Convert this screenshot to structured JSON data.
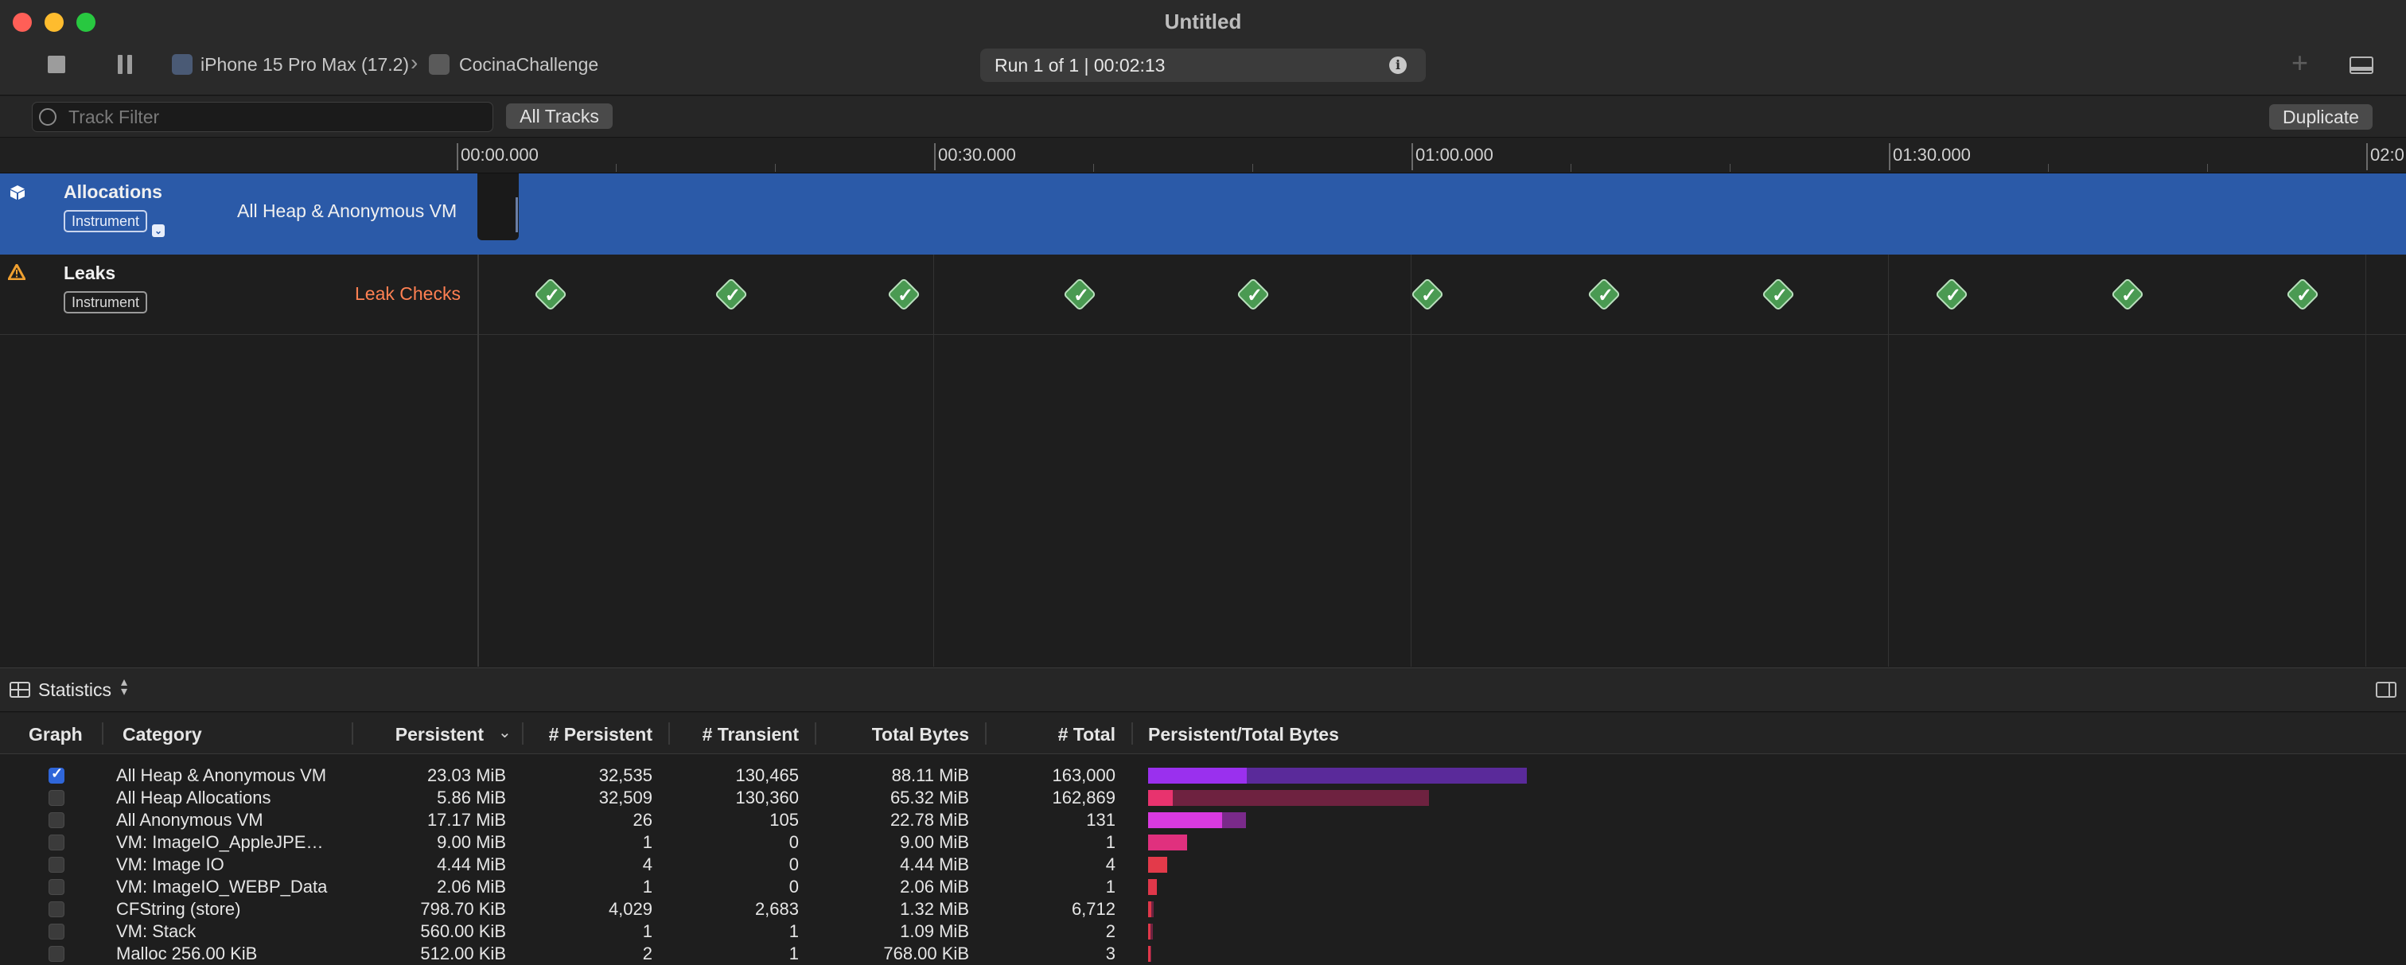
{
  "window": {
    "title": "Untitled",
    "device": "iPhone 15 Pro Max (17.2)",
    "app": "CocinaChallenge",
    "run_status": "Run 1 of 1  |  00:02:13",
    "traffic_lights": {
      "close": "#ff5f57",
      "minimize": "#febc2e",
      "zoom": "#28c840"
    }
  },
  "filterbar": {
    "placeholder": "Track Filter",
    "all_tracks": "All Tracks",
    "duplicate": "Duplicate"
  },
  "timeline": {
    "labels": [
      "00:00.000",
      "00:30.000",
      "01:00.000",
      "01:30.000",
      "02:0"
    ]
  },
  "tracks": {
    "allocations": {
      "name": "Allocations",
      "badge": "Instrument",
      "detail": "All Heap & Anonymous VM",
      "icon": "cube-icon"
    },
    "leaks": {
      "name": "Leaks",
      "badge": "Instrument",
      "detail": "Leak Checks",
      "icon": "warning-triangle-icon",
      "check_count": 11
    }
  },
  "stats": {
    "title": "Statistics",
    "columns": [
      "Graph",
      "Category",
      "Persistent",
      "# Persistent",
      "# Transient",
      "Total Bytes",
      "# Total",
      "Persistent/Total Bytes"
    ],
    "rows": [
      {
        "graph": true,
        "category": "All Heap & Anonymous VM",
        "persistent": "23.03 MiB",
        "n_persistent": "32,535",
        "n_transient": "130,465",
        "total_bytes": "88.11 MiB",
        "n_total": "163,000",
        "persistent_frac": 0.26,
        "total_frac": 1.0,
        "color": "#9a30ee",
        "color2": "#5a2a9a"
      },
      {
        "graph": false,
        "category": "All Heap Allocations",
        "persistent": "5.86 MiB",
        "n_persistent": "32,509",
        "n_transient": "130,360",
        "total_bytes": "65.32 MiB",
        "n_total": "162,869",
        "persistent_frac": 0.066,
        "total_frac": 0.741,
        "color": "#e8336e",
        "color2": "#6e2240"
      },
      {
        "graph": false,
        "category": "All Anonymous VM",
        "persistent": "17.17 MiB",
        "n_persistent": "26",
        "n_transient": "105",
        "total_bytes": "22.78 MiB",
        "n_total": "131",
        "persistent_frac": 0.195,
        "total_frac": 0.259,
        "color": "#d93ae0",
        "color2": "#7a2a8a"
      },
      {
        "graph": false,
        "category": "VM: ImageIO_AppleJPE…",
        "persistent": "9.00 MiB",
        "n_persistent": "1",
        "n_transient": "0",
        "total_bytes": "9.00 MiB",
        "n_total": "1",
        "persistent_frac": 0.102,
        "total_frac": 0.102,
        "color": "#e0307e",
        "color2": "#6e2240"
      },
      {
        "graph": false,
        "category": "VM: Image IO",
        "persistent": "4.44 MiB",
        "n_persistent": "4",
        "n_transient": "0",
        "total_bytes": "4.44 MiB",
        "n_total": "4",
        "persistent_frac": 0.05,
        "total_frac": 0.05,
        "color": "#e33a4a",
        "color2": "#6e2240"
      },
      {
        "graph": false,
        "category": "VM: ImageIO_WEBP_Data",
        "persistent": "2.06 MiB",
        "n_persistent": "1",
        "n_transient": "0",
        "total_bytes": "2.06 MiB",
        "n_total": "1",
        "persistent_frac": 0.023,
        "total_frac": 0.023,
        "color": "#e0374a",
        "color2": "#6e2240"
      },
      {
        "graph": false,
        "category": "CFString (store)",
        "persistent": "798.70 KiB",
        "n_persistent": "4,029",
        "n_transient": "2,683",
        "total_bytes": "1.32 MiB",
        "n_total": "6,712",
        "persistent_frac": 0.009,
        "total_frac": 0.015,
        "color": "#e0374a",
        "color2": "#6e2240"
      },
      {
        "graph": false,
        "category": "VM: Stack",
        "persistent": "560.00 KiB",
        "n_persistent": "1",
        "n_transient": "1",
        "total_bytes": "1.09 MiB",
        "n_total": "2",
        "persistent_frac": 0.006,
        "total_frac": 0.012,
        "color": "#e0374a",
        "color2": "#6e2240"
      },
      {
        "graph": false,
        "category": "Malloc 256.00 KiB",
        "persistent": "512.00 KiB",
        "n_persistent": "2",
        "n_transient": "1",
        "total_bytes": "768.00 KiB",
        "n_total": "3",
        "persistent_frac": 0.006,
        "total_frac": 0.008,
        "color": "#e0374a",
        "color2": "#6e2240"
      }
    ]
  }
}
